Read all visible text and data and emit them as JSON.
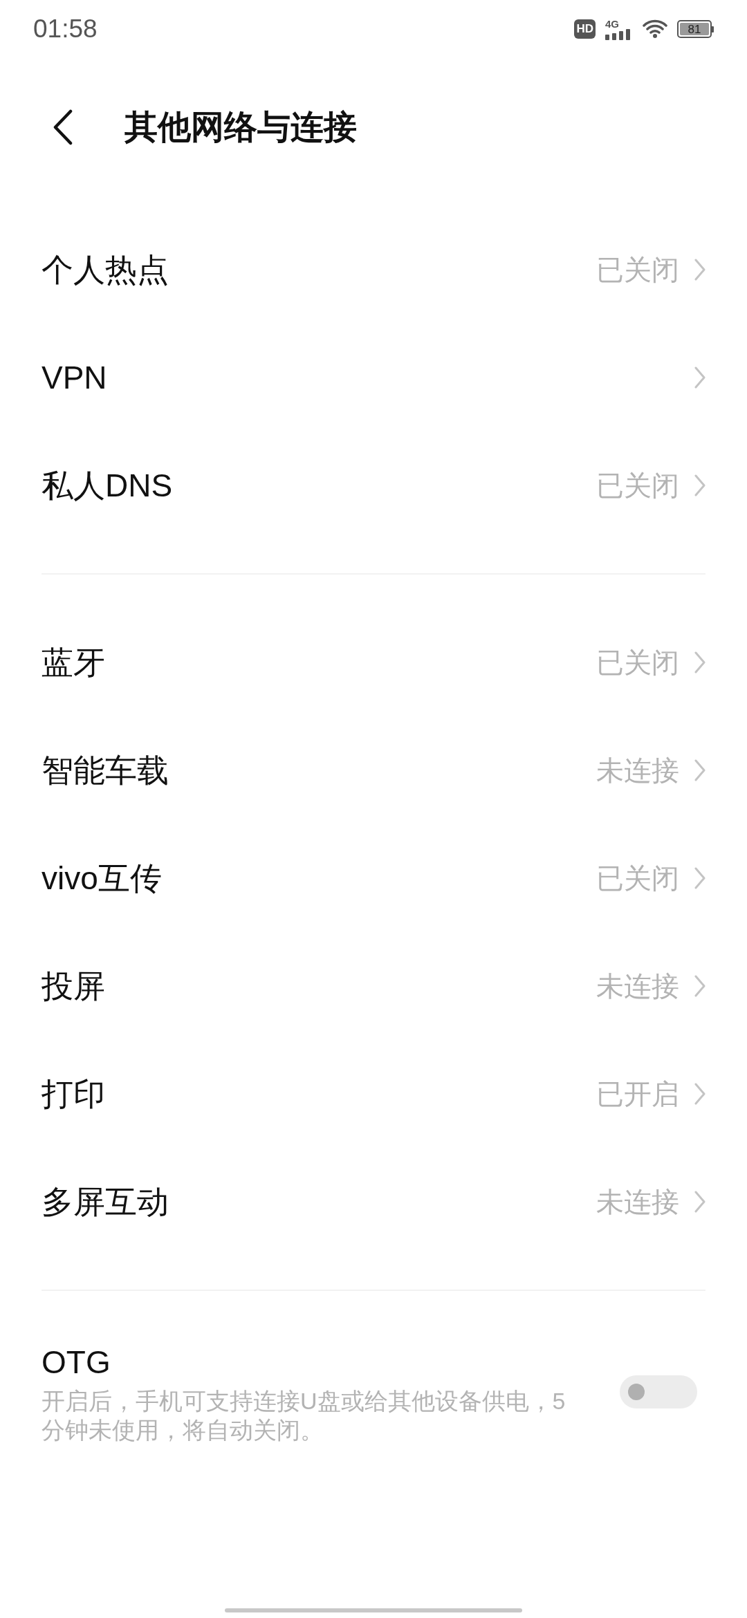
{
  "status_bar": {
    "time": "01:58",
    "hd": "HD",
    "network": "4G",
    "battery": "81"
  },
  "header": {
    "title": "其他网络与连接"
  },
  "groups": [
    {
      "items": [
        {
          "label": "个人热点",
          "value": "已关闭"
        },
        {
          "label": "VPN"
        },
        {
          "label": "私人DNS",
          "value": "已关闭"
        }
      ]
    },
    {
      "items": [
        {
          "label": "蓝牙",
          "value": "已关闭"
        },
        {
          "label": "智能车载",
          "value": "未连接"
        },
        {
          "label": "vivo互传",
          "value": "已关闭"
        },
        {
          "label": "投屏",
          "value": "未连接"
        },
        {
          "label": "打印",
          "value": "已开启"
        },
        {
          "label": "多屏互动",
          "value": "未连接"
        }
      ]
    }
  ],
  "otg": {
    "title": "OTG",
    "description": "开启后，手机可支持连接U盘或给其他设备供电，5分钟未使用，将自动关闭。",
    "on": false
  }
}
